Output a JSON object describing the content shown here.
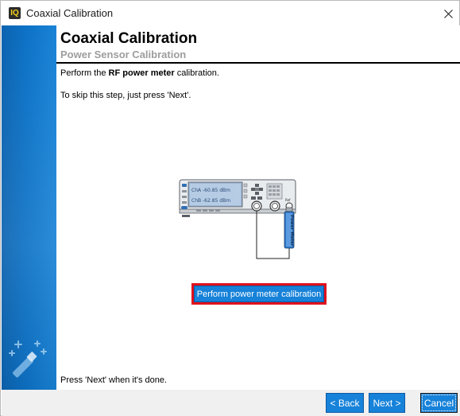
{
  "window": {
    "title": "Coaxial Calibration",
    "app_icon_text": "IQ"
  },
  "page": {
    "heading": "Coaxial Calibration",
    "subheading": "Power Sensor Calibration",
    "instruction_prefix": "Perform the ",
    "instruction_bold": "RF power meter",
    "instruction_suffix": " calibration.",
    "skip_text": "To skip this step, just press 'Next'.",
    "done_text": "Press 'Next' when it's done."
  },
  "diagram": {
    "channel_a": "ChA  -60.85 dBm",
    "channel_b": "ChB  -62.85 dBm",
    "ref_label": "Ref",
    "sensor_label": "Power Meter"
  },
  "actions": {
    "perform_label": "Perform power meter calibration",
    "back_label": "< Back",
    "next_label": "Next >",
    "cancel_label": "Cancel"
  },
  "colors": {
    "accent": "#1782d9",
    "highlight_border": "#e0121d",
    "sidebar": "#0d72c6"
  },
  "icons": {
    "close": "close-icon",
    "wand": "magic-wand-icon",
    "app": "app-icon"
  }
}
